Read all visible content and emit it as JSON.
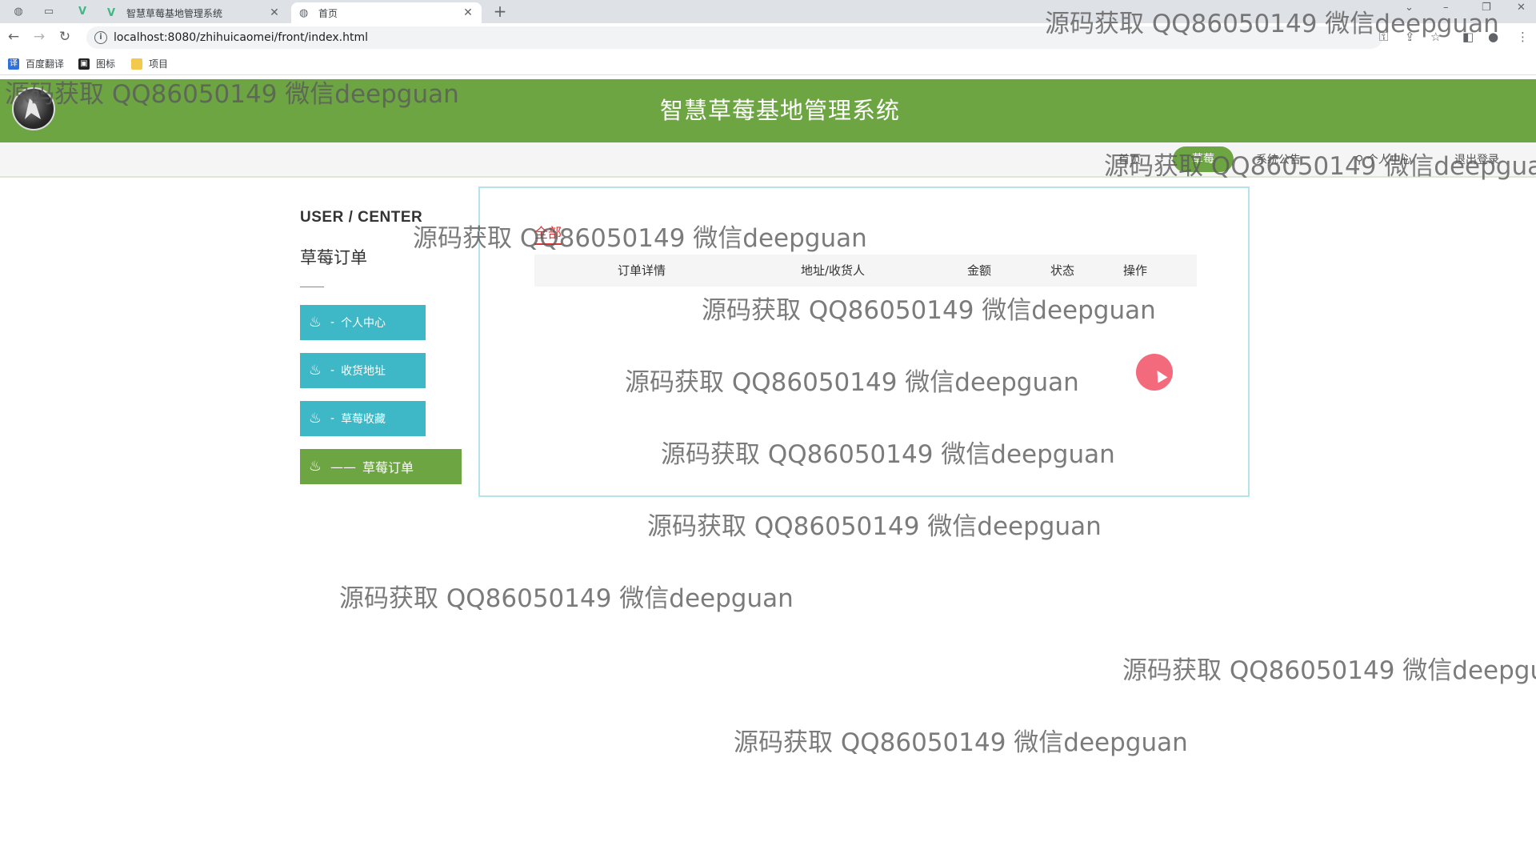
{
  "browser": {
    "tabs": [
      {
        "label": "智慧草莓基地管理系统",
        "icon": "vue-logo-icon",
        "active": false
      },
      {
        "label": "首页",
        "icon": "globe-icon",
        "active": true
      }
    ],
    "new_tab_symbol": "+",
    "url": "localhost:8080/zhihuicaomei/front/index.html",
    "bookmarks": [
      {
        "label": "百度翻译",
        "icon": "translate-icon",
        "color": "#2f6fde"
      },
      {
        "label": "图标",
        "icon": "bookmark-icon",
        "color": "#222222"
      },
      {
        "label": "项目",
        "icon": "folder-icon",
        "color": "#f2c94c"
      }
    ]
  },
  "site": {
    "title": "智慧草莓基地管理系统",
    "header_color": "#6da543",
    "nav": {
      "items": [
        "首页",
        "草莓",
        "系统公告",
        "个人中心",
        "退出登录"
      ],
      "active": "草莓"
    }
  },
  "user_center": {
    "title": "USER / CENTER",
    "subtitle": "草莓订单",
    "menu": [
      {
        "label": "个人中心",
        "dash": "-",
        "active": false
      },
      {
        "label": "收货地址",
        "dash": "-",
        "active": false
      },
      {
        "label": "草莓收藏",
        "dash": "-",
        "active": false
      },
      {
        "label": "草莓订单",
        "dash": "——",
        "active": true
      }
    ],
    "menu_color": "#3eb7c6",
    "menu_active_color": "#6da543"
  },
  "orders": {
    "filter_tab": "全部",
    "columns": [
      "订单详情",
      "地址/收货人",
      "金额",
      "状态",
      "操作"
    ],
    "rows": []
  },
  "watermark": "源码获取 QQ86050149 微信deepguan"
}
